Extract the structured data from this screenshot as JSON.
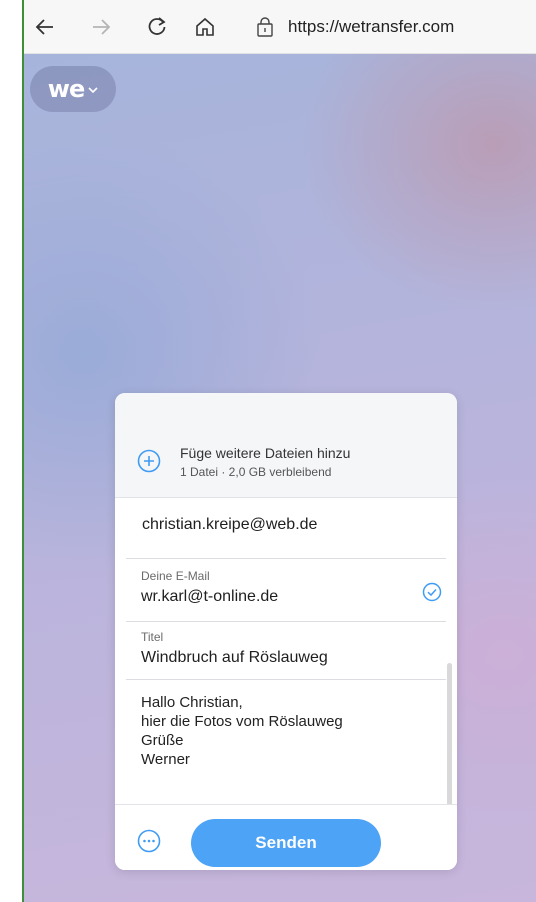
{
  "browser": {
    "url": "https://wetransfer.com",
    "icons": [
      "back-arrow-icon",
      "forward-arrow-icon",
      "reload-icon",
      "home-icon",
      "info-icon"
    ]
  },
  "app": {
    "logo_text": "we",
    "logo_menu": "chevron-down-icon"
  },
  "upload": {
    "add_files_title": "Füge weitere Dateien hinzu",
    "add_files_sub": "1 Datei · 2,0 GB verbleibend"
  },
  "form": {
    "recipient_email": "christian.kreipe@web.de",
    "sender_label": "Deine E-Mail",
    "sender_email": "wr.karl@t-online.de",
    "title_label": "Titel",
    "title_value": "Windbruch auf Röslauweg",
    "message_lines": [
      "Hallo Christian,",
      "hier die Fotos vom Röslauweg",
      "Grüße",
      "Werner"
    ]
  },
  "footer": {
    "send_label": "Senden"
  },
  "colors": {
    "accent": "#4da3f5",
    "check": "#409cf2"
  }
}
